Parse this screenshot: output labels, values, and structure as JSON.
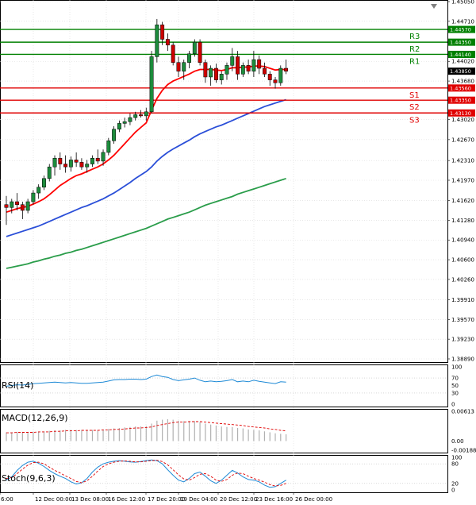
{
  "chart_data": {
    "type": "candlestick",
    "price_axis_ticks": [
      "1.45050",
      "1.44710",
      "1.44020",
      "1.43680",
      "1.43020",
      "1.42670",
      "1.42310",
      "1.41970",
      "1.41620",
      "1.41280",
      "1.40940",
      "1.40600",
      "1.40260",
      "1.39910",
      "1.39570",
      "1.39230",
      "1.38890"
    ],
    "price_axis_range": [
      1.3889,
      1.4505
    ],
    "x_labels": [
      "6:00",
      "12 Dec 00:00",
      "13 Dec 08:00",
      "16 Dec 12:00",
      "17 Dec 20:00",
      "19 Dec 04:00",
      "20 Dec 12:00",
      "23 Dec 16:00",
      "26 Dec 00:00"
    ],
    "candles": [
      [
        1.4155,
        1.417,
        1.412,
        1.415
      ],
      [
        1.415,
        1.4165,
        1.414,
        1.416
      ],
      [
        1.416,
        1.4175,
        1.4145,
        1.4155
      ],
      [
        1.4155,
        1.416,
        1.413,
        1.4145
      ],
      [
        1.4145,
        1.4165,
        1.414,
        1.416
      ],
      [
        1.416,
        1.418,
        1.4155,
        1.4175
      ],
      [
        1.4175,
        1.419,
        1.4165,
        1.4185
      ],
      [
        1.4185,
        1.4205,
        1.418,
        1.42
      ],
      [
        1.42,
        1.4225,
        1.4195,
        1.422
      ],
      [
        1.422,
        1.424,
        1.4205,
        1.4235
      ],
      [
        1.4235,
        1.4245,
        1.4215,
        1.4225
      ],
      [
        1.4225,
        1.424,
        1.421,
        1.422
      ],
      [
        1.422,
        1.4238,
        1.4212,
        1.4232
      ],
      [
        1.4232,
        1.4245,
        1.422,
        1.4228
      ],
      [
        1.4228,
        1.4235,
        1.4215,
        1.422
      ],
      [
        1.422,
        1.4232,
        1.421,
        1.4225
      ],
      [
        1.4225,
        1.424,
        1.422,
        1.4235
      ],
      [
        1.4235,
        1.425,
        1.4225,
        1.423
      ],
      [
        1.423,
        1.425,
        1.4222,
        1.4245
      ],
      [
        1.4245,
        1.427,
        1.424,
        1.4265
      ],
      [
        1.4265,
        1.429,
        1.426,
        1.4285
      ],
      [
        1.4285,
        1.43,
        1.428,
        1.4295
      ],
      [
        1.4295,
        1.4305,
        1.4288,
        1.4298
      ],
      [
        1.4298,
        1.4312,
        1.4292,
        1.4305
      ],
      [
        1.4305,
        1.4315,
        1.43,
        1.431
      ],
      [
        1.431,
        1.4318,
        1.4305,
        1.4308
      ],
      [
        1.4308,
        1.4322,
        1.43,
        1.4315
      ],
      [
        1.4315,
        1.442,
        1.4312,
        1.441
      ],
      [
        1.441,
        1.4475,
        1.44,
        1.4465
      ],
      [
        1.4465,
        1.447,
        1.443,
        1.444
      ],
      [
        1.444,
        1.445,
        1.442,
        1.443
      ],
      [
        1.443,
        1.4435,
        1.4395,
        1.44
      ],
      [
        1.44,
        1.441,
        1.4375,
        1.4385
      ],
      [
        1.4385,
        1.4405,
        1.437,
        1.44
      ],
      [
        1.44,
        1.442,
        1.439,
        1.4415
      ],
      [
        1.4415,
        1.444,
        1.441,
        1.4435
      ],
      [
        1.4435,
        1.444,
        1.4395,
        1.44
      ],
      [
        1.44,
        1.4405,
        1.4365,
        1.4375
      ],
      [
        1.4375,
        1.4395,
        1.436,
        1.439
      ],
      [
        1.439,
        1.4398,
        1.4365,
        1.437
      ],
      [
        1.437,
        1.4385,
        1.4362,
        1.438
      ],
      [
        1.438,
        1.44,
        1.437,
        1.4395
      ],
      [
        1.4395,
        1.4425,
        1.4385,
        1.441
      ],
      [
        1.441,
        1.442,
        1.437,
        1.438
      ],
      [
        1.438,
        1.44,
        1.4375,
        1.4395
      ],
      [
        1.4395,
        1.4405,
        1.438,
        1.4385
      ],
      [
        1.4385,
        1.442,
        1.4375,
        1.4405
      ],
      [
        1.4405,
        1.4412,
        1.438,
        1.439
      ],
      [
        1.439,
        1.44,
        1.4375,
        1.438
      ],
      [
        1.438,
        1.4385,
        1.436,
        1.437
      ],
      [
        1.437,
        1.4375,
        1.4355,
        1.4365
      ],
      [
        1.4365,
        1.4395,
        1.436,
        1.439
      ],
      [
        1.439,
        1.4405,
        1.438,
        1.4385
      ]
    ],
    "moving_averages": [
      {
        "color": "#ff0000",
        "values": [
          1.4142,
          1.4145,
          1.4148,
          1.415,
          1.4152,
          1.4156,
          1.416,
          1.4165,
          1.4172,
          1.418,
          1.4188,
          1.4194,
          1.42,
          1.4205,
          1.4208,
          1.4212,
          1.4216,
          1.422,
          1.4225,
          1.4232,
          1.424,
          1.425,
          1.426,
          1.427,
          1.428,
          1.4288,
          1.4296,
          1.4318,
          1.4338,
          1.4352,
          1.4362,
          1.4368,
          1.4372,
          1.4376,
          1.438,
          1.4385,
          1.4388,
          1.4388,
          1.4388,
          1.4387,
          1.4386,
          1.4388,
          1.4391,
          1.4391,
          1.4392,
          1.4392,
          1.4394,
          1.4394,
          1.4393,
          1.439,
          1.4387,
          1.4388,
          1.4388
        ]
      },
      {
        "color": "#2b4fd8",
        "values": [
          1.41,
          1.4103,
          1.4106,
          1.4109,
          1.4112,
          1.4115,
          1.4118,
          1.4122,
          1.4126,
          1.413,
          1.4134,
          1.4138,
          1.4142,
          1.4146,
          1.415,
          1.4153,
          1.4157,
          1.4161,
          1.4165,
          1.417,
          1.4175,
          1.4181,
          1.4187,
          1.4193,
          1.42,
          1.4206,
          1.4212,
          1.422,
          1.423,
          1.4238,
          1.4245,
          1.4251,
          1.4256,
          1.4261,
          1.4266,
          1.4272,
          1.4277,
          1.4281,
          1.4285,
          1.4289,
          1.4292,
          1.4296,
          1.43,
          1.4304,
          1.4308,
          1.4312,
          1.4316,
          1.432,
          1.4324,
          1.4327,
          1.433,
          1.4333,
          1.4336
        ]
      },
      {
        "color": "#2a9d4a",
        "values": [
          1.4045,
          1.4047,
          1.4049,
          1.4051,
          1.4053,
          1.4056,
          1.4058,
          1.4061,
          1.4063,
          1.4066,
          1.4068,
          1.4071,
          1.4073,
          1.4076,
          1.4078,
          1.4081,
          1.4084,
          1.4087,
          1.409,
          1.4093,
          1.4096,
          1.4099,
          1.4102,
          1.4105,
          1.4108,
          1.4111,
          1.4114,
          1.4118,
          1.4122,
          1.4126,
          1.413,
          1.4133,
          1.4136,
          1.4139,
          1.4142,
          1.4146,
          1.415,
          1.4154,
          1.4157,
          1.416,
          1.4163,
          1.4166,
          1.4169,
          1.4173,
          1.4176,
          1.4179,
          1.4182,
          1.4185,
          1.4188,
          1.4191,
          1.4194,
          1.4197,
          1.42
        ]
      }
    ],
    "levels": [
      {
        "name": "R3",
        "value": 1.4457,
        "tag": "1.44570",
        "color": "#008000"
      },
      {
        "name": "R2",
        "value": 1.4435,
        "tag": "1.44350",
        "color": "#008000"
      },
      {
        "name": "R1",
        "value": 1.4414,
        "tag": "1.44140",
        "color": "#008000"
      },
      {
        "name": "S1",
        "value": 1.4356,
        "tag": "1.43560",
        "color": "#e00000"
      },
      {
        "name": "S2",
        "value": 1.4335,
        "tag": "1.43350",
        "color": "#e00000"
      },
      {
        "name": "S3",
        "value": 1.4313,
        "tag": "1.43130",
        "color": "#e00000"
      }
    ],
    "current_price": {
      "value": 1.4385,
      "tag": "1.43850"
    },
    "rsi": {
      "label": "RSI(14)",
      "ticks": [
        "100",
        "70",
        "50",
        "30",
        "0"
      ],
      "values": [
        48,
        50,
        52,
        51,
        53,
        55,
        56,
        57,
        58,
        59,
        58,
        57,
        58,
        57,
        56,
        56,
        57,
        58,
        59,
        62,
        65,
        66,
        66,
        67,
        67,
        66,
        67,
        74,
        78,
        74,
        72,
        66,
        63,
        65,
        67,
        70,
        64,
        60,
        62,
        60,
        61,
        63,
        66,
        60,
        62,
        60,
        64,
        61,
        59,
        57,
        55,
        60,
        59
      ]
    },
    "macd": {
      "label": "MACD(12,26,9)",
      "ticks": [
        "0.00613",
        "0.00",
        "-0.001887"
      ],
      "histogram": [
        0.0018,
        0.0018,
        0.0019,
        0.0019,
        0.0019,
        0.0019,
        0.0019,
        0.002,
        0.0021,
        0.0022,
        0.0022,
        0.0023,
        0.0023,
        0.0023,
        0.0023,
        0.0023,
        0.0023,
        0.0023,
        0.0024,
        0.0025,
        0.0026,
        0.0027,
        0.0028,
        0.0029,
        0.003,
        0.003,
        0.0031,
        0.0036,
        0.0042,
        0.0044,
        0.0045,
        0.0044,
        0.0042,
        0.0041,
        0.0041,
        0.0041,
        0.0039,
        0.0036,
        0.0034,
        0.0032,
        0.003,
        0.0029,
        0.0029,
        0.0027,
        0.0026,
        0.0024,
        0.0023,
        0.0022,
        0.002,
        0.0018,
        0.0016,
        0.0015,
        0.0014
      ],
      "signal": [
        0.0017,
        0.0017,
        0.0018,
        0.0018,
        0.0018,
        0.0018,
        0.0019,
        0.0019,
        0.0019,
        0.002,
        0.002,
        0.0021,
        0.0021,
        0.0021,
        0.0022,
        0.0022,
        0.0022,
        0.0022,
        0.0023,
        0.0023,
        0.0024,
        0.0024,
        0.0025,
        0.0026,
        0.0027,
        0.0027,
        0.0028,
        0.0029,
        0.0032,
        0.0034,
        0.0036,
        0.0038,
        0.0039,
        0.0039,
        0.004,
        0.004,
        0.004,
        0.0039,
        0.0038,
        0.0037,
        0.0036,
        0.0035,
        0.0034,
        0.0033,
        0.0032,
        0.003,
        0.0029,
        0.0028,
        0.0027,
        0.0025,
        0.0024,
        0.0022,
        0.0021
      ]
    },
    "stoch": {
      "label": "Stoch(9,6,3)",
      "ticks": [
        "100",
        "80",
        "20",
        "0"
      ],
      "main": [
        30,
        40,
        60,
        75,
        85,
        88,
        82,
        72,
        60,
        50,
        42,
        35,
        25,
        18,
        22,
        35,
        55,
        70,
        80,
        85,
        88,
        90,
        88,
        86,
        85,
        87,
        90,
        92,
        90,
        80,
        62,
        45,
        30,
        25,
        35,
        50,
        55,
        42,
        28,
        20,
        30,
        45,
        60,
        52,
        40,
        32,
        30,
        25,
        15,
        8,
        10,
        20,
        30
      ],
      "signal": [
        35,
        38,
        50,
        64,
        76,
        84,
        85,
        80,
        70,
        60,
        52,
        43,
        35,
        26,
        22,
        28,
        42,
        58,
        72,
        80,
        85,
        88,
        89,
        88,
        86,
        86,
        88,
        90,
        91,
        87,
        77,
        62,
        46,
        34,
        30,
        38,
        48,
        50,
        42,
        30,
        26,
        32,
        45,
        52,
        50,
        42,
        35,
        30,
        24,
        16,
        12,
        14,
        20
      ]
    }
  }
}
